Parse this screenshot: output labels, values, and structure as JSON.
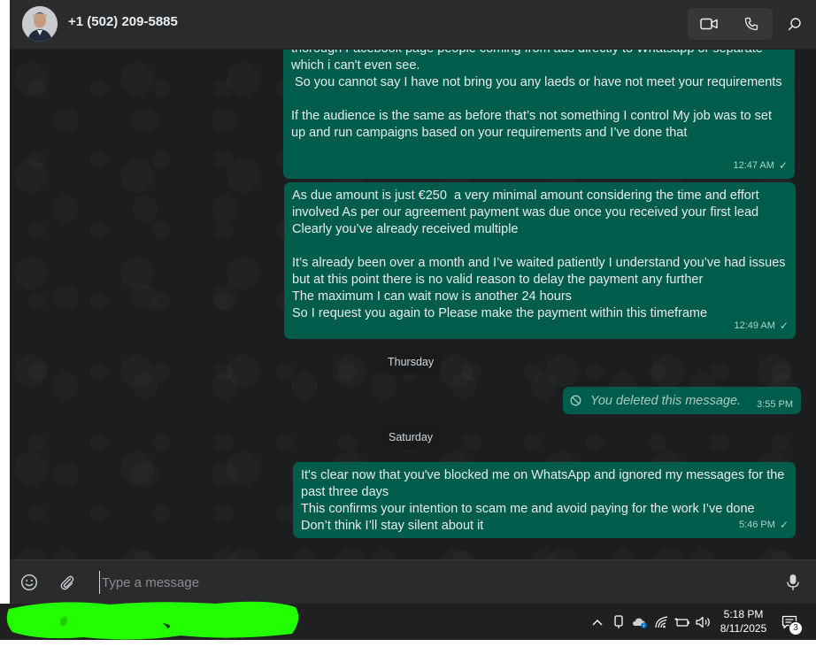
{
  "header": {
    "contact_name": "+1 (502) 209-5885",
    "icons": [
      "video-call-icon",
      "voice-call-icon",
      "search-icon"
    ]
  },
  "messages": [
    {
      "text": "thorough Facebook page people coming from ads directly to Whatsapp or separate which i can't even see.\n So you cannot say I have not bring you any laeds or have not meet your requirements\n\nIf the audience is the same as before that’s not something I control My job was to set up and run campaigns based on your requirements and I’ve done that",
      "time": "12:47 AM",
      "status": "✓"
    },
    {
      "text": "As due amount is just €250  a very minimal amount considering the time and effort involved As per our agreement payment was due once you received your first lead Clearly you’ve already received multiple\n\nIt’s already been over a month and I’ve waited patiently I understand you’ve had issues but at this point there is no valid reason to delay the payment any further\nThe maximum I can wait now is another 24 hours\nSo I request you again to Please make the payment within this timeframe",
      "time": "12:49 AM",
      "status": "✓"
    },
    {
      "text": "It's clear now that you've blocked me on WhatsApp and ignored my messages for the past three days\nThis confirms your intention to scam me and avoid paying for the work I’ve done\nDon’t think I’ll stay silent about it",
      "time": "5:46 PM",
      "status": "✓"
    }
  ],
  "day_separators": [
    "Thursday",
    "Saturday"
  ],
  "deleted_message": {
    "text": "You deleted this message.",
    "time": "3:55 PM"
  },
  "composer": {
    "placeholder": "Type a message"
  },
  "taskbar": {
    "time": "5:18 PM",
    "date": "8/11/2025",
    "notification_count": "3"
  },
  "colors": {
    "outgoing_bubble": "#005c4b",
    "chat_bg": "#1c1d1f",
    "header_bg": "#2a2b2d",
    "redaction": "#22ff00"
  }
}
